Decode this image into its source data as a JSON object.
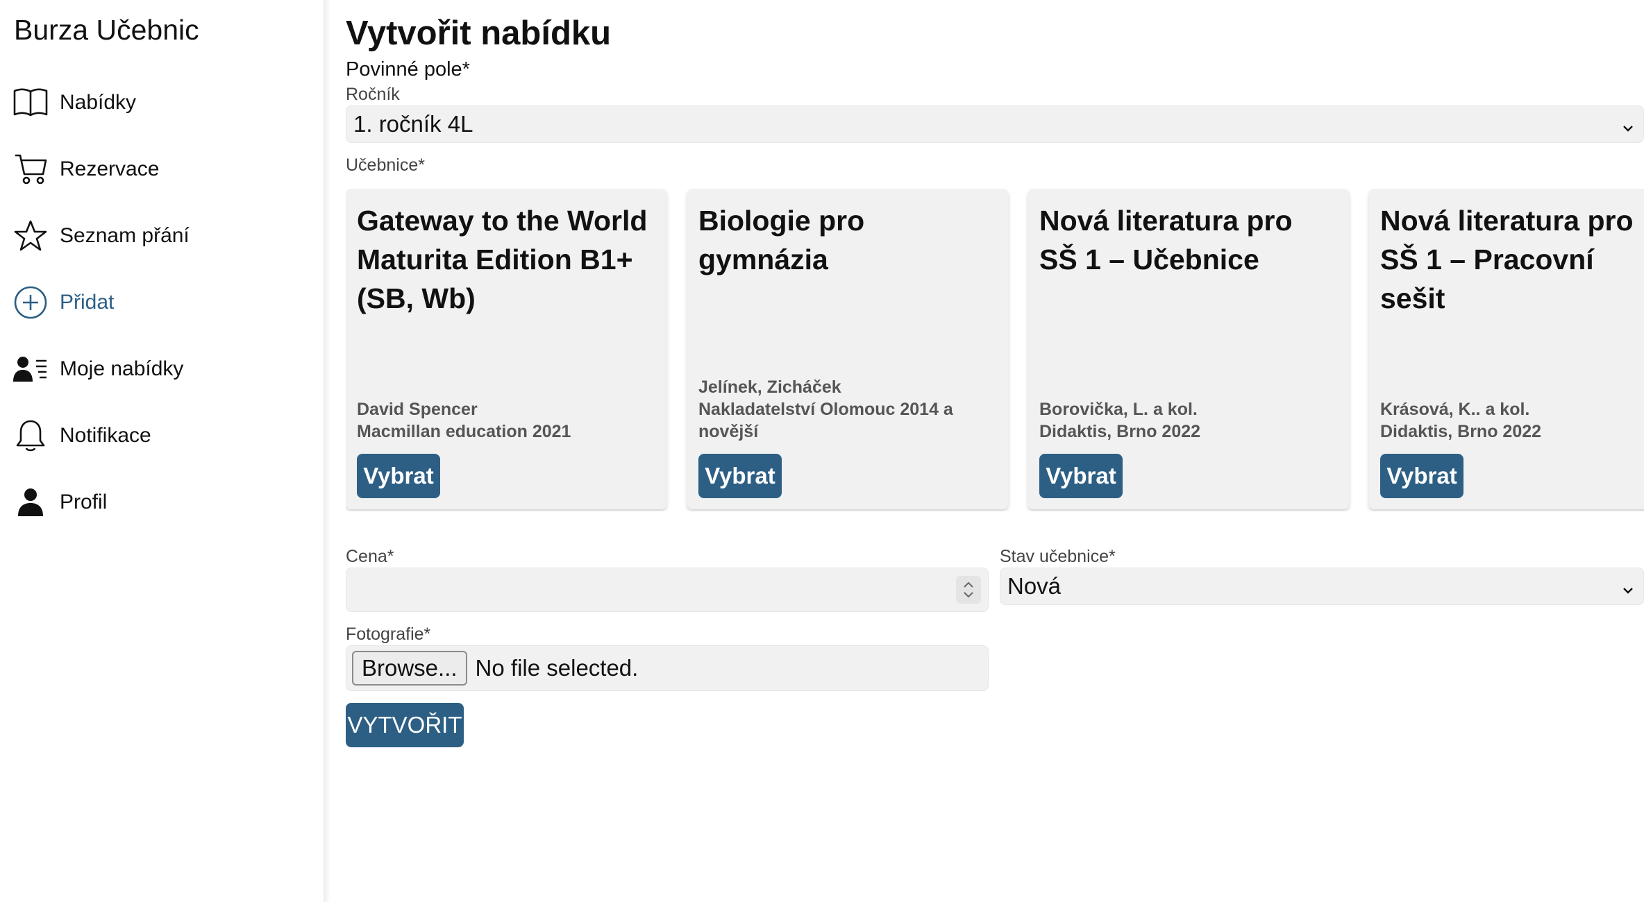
{
  "app": {
    "title": "Burza Učebnic"
  },
  "sidebar": {
    "items": [
      {
        "label": "Nabídky",
        "icon": "book-icon"
      },
      {
        "label": "Rezervace",
        "icon": "cart-icon"
      },
      {
        "label": "Seznam přání",
        "icon": "star-icon"
      },
      {
        "label": "Přidat",
        "icon": "plus-circle-icon",
        "active": true
      },
      {
        "label": "Moje nabídky",
        "icon": "user-list-icon"
      },
      {
        "label": "Notifikace",
        "icon": "bell-icon"
      },
      {
        "label": "Profil",
        "icon": "person-icon"
      }
    ]
  },
  "form": {
    "title": "Vytvořit nabídku",
    "required_note": "Povinné pole*",
    "grade": {
      "label": "Ročník",
      "value": "1. ročník 4L"
    },
    "textbook_label": "Učebnice*",
    "textbooks": [
      {
        "title": "Gateway to the World Maturita Edition B1+ (SB, Wb)",
        "author": "David Spencer",
        "publisher": "Macmillan education 2021",
        "button": "Vybrat"
      },
      {
        "title": "Biologie pro gymnázia",
        "author": "Jelínek, Zicháček",
        "publisher": "Nakladatelství Olomouc 2014 a novější",
        "button": "Vybrat"
      },
      {
        "title": "Nová literatura pro SŠ 1 – Učebnice",
        "author": "Borovička, L. a kol.",
        "publisher": "Didaktis, Brno 2022",
        "button": "Vybrat"
      },
      {
        "title": "Nová literatura pro SŠ 1 – Pracovní sešit",
        "author": "Krásová, K.. a kol.",
        "publisher": "Didaktis, Brno 2022",
        "button": "Vybrat"
      }
    ],
    "price": {
      "label": "Cena*",
      "value": ""
    },
    "condition": {
      "label": "Stav učebnice*",
      "value": "Nová"
    },
    "photo": {
      "label": "Fotografie*",
      "browse_label": "Browse...",
      "status": "No file selected."
    },
    "submit_label": "VYTVOŘIT"
  },
  "colors": {
    "accent": "#2d5f85",
    "field_bg": "#f1f1f1"
  }
}
